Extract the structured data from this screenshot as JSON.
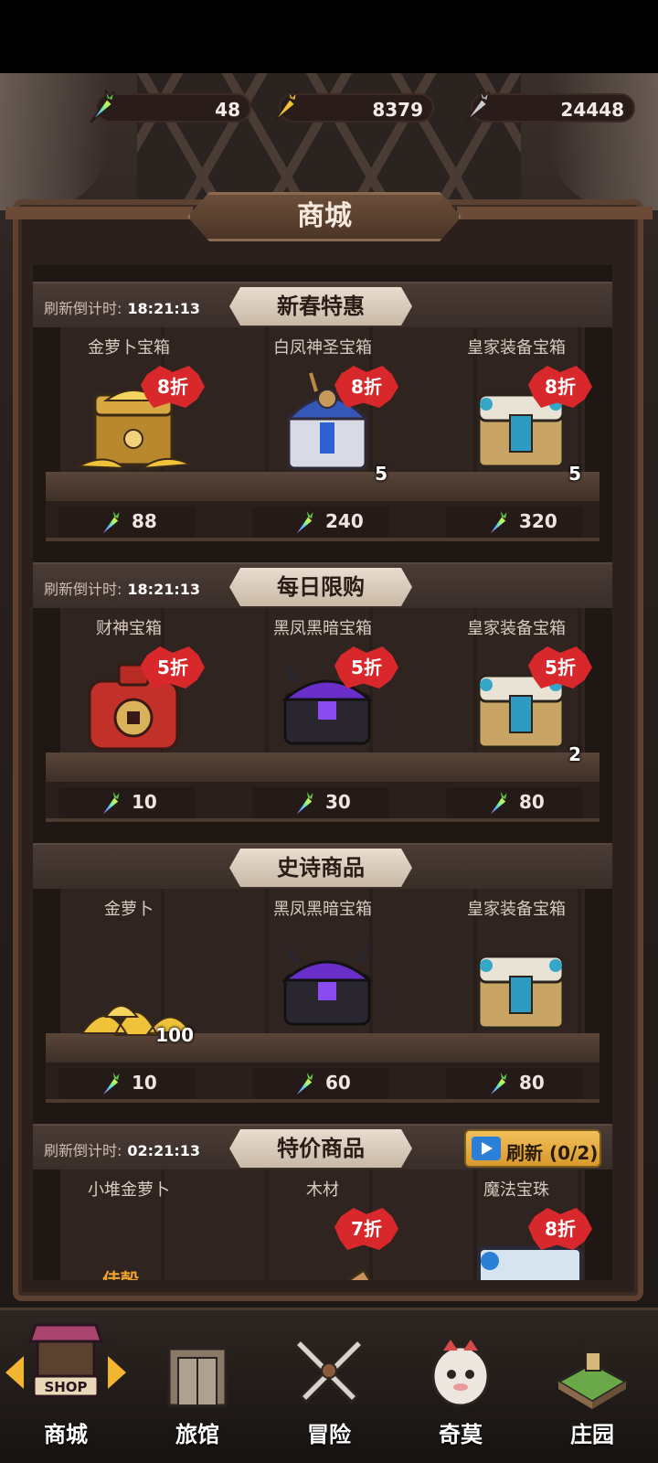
{
  "currencies": [
    {
      "icon": "rainbow-carrot-icon",
      "value": "48"
    },
    {
      "icon": "gold-carrot-icon",
      "value": "8379"
    },
    {
      "icon": "silver-carrot-icon",
      "value": "24448"
    }
  ],
  "title": "商城",
  "sections": [
    {
      "countdown_label": "刷新倒计时:",
      "countdown": "18:21:13",
      "title": "新春特惠",
      "items": [
        {
          "name": "金萝卜宝箱",
          "discount": "8折",
          "count": "",
          "price": "88",
          "art": "gold-carrot-chest"
        },
        {
          "name": "白凤神圣宝箱",
          "discount": "8折",
          "count": "5",
          "price": "240",
          "art": "white-phoenix-chest"
        },
        {
          "name": "皇家装备宝箱",
          "discount": "8折",
          "count": "5",
          "price": "320",
          "art": "royal-equipment-chest"
        }
      ]
    },
    {
      "countdown_label": "刷新倒计时:",
      "countdown": "18:21:13",
      "title": "每日限购",
      "items": [
        {
          "name": "财神宝箱",
          "discount": "5折",
          "count": "",
          "price": "10",
          "art": "fortune-god-chest"
        },
        {
          "name": "黑凤黑暗宝箱",
          "discount": "5折",
          "count": "",
          "price": "30",
          "art": "black-phoenix-chest"
        },
        {
          "name": "皇家装备宝箱",
          "discount": "5折",
          "count": "2",
          "price": "80",
          "art": "royal-equipment-chest"
        }
      ]
    },
    {
      "countdown_label": "",
      "countdown": "",
      "title": "史诗商品",
      "items": [
        {
          "name": "金萝卜",
          "discount": "",
          "count": "100",
          "price": "10",
          "art": "gold-carrot-pile"
        },
        {
          "name": "黑凤黑暗宝箱",
          "discount": "",
          "count": "",
          "price": "60",
          "art": "black-phoenix-chest"
        },
        {
          "name": "皇家装备宝箱",
          "discount": "",
          "count": "",
          "price": "80",
          "art": "royal-equipment-chest"
        }
      ]
    },
    {
      "countdown_label": "刷新倒计时:",
      "countdown": "02:21:13",
      "title": "特价商品",
      "refresh_label": "刷新 (0/2)",
      "items": [
        {
          "name": "小堆金萝卜",
          "discount": "",
          "count": "",
          "price": "",
          "art": "small-gold-carrot-pile",
          "tag": "佳殻"
        },
        {
          "name": "木材",
          "discount": "7折",
          "count": "",
          "price": "",
          "art": "wood"
        },
        {
          "name": "魔法宝珠",
          "discount": "8折",
          "count": "",
          "price": "",
          "art": "magic-orb"
        }
      ]
    }
  ],
  "nav": [
    {
      "label": "商城",
      "icon": "shop-icon",
      "active": true,
      "sign": "SHOP"
    },
    {
      "label": "旅馆",
      "icon": "inn-icon"
    },
    {
      "label": "冒险",
      "icon": "crossed-swords-icon"
    },
    {
      "label": "奇莫",
      "icon": "chimo-character-icon"
    },
    {
      "label": "庄园",
      "icon": "manor-island-icon"
    }
  ],
  "colors": {
    "discount_badge": "#d8282b",
    "refresh_button": "#f3c05a",
    "nav_arrow": "#f2b531"
  }
}
